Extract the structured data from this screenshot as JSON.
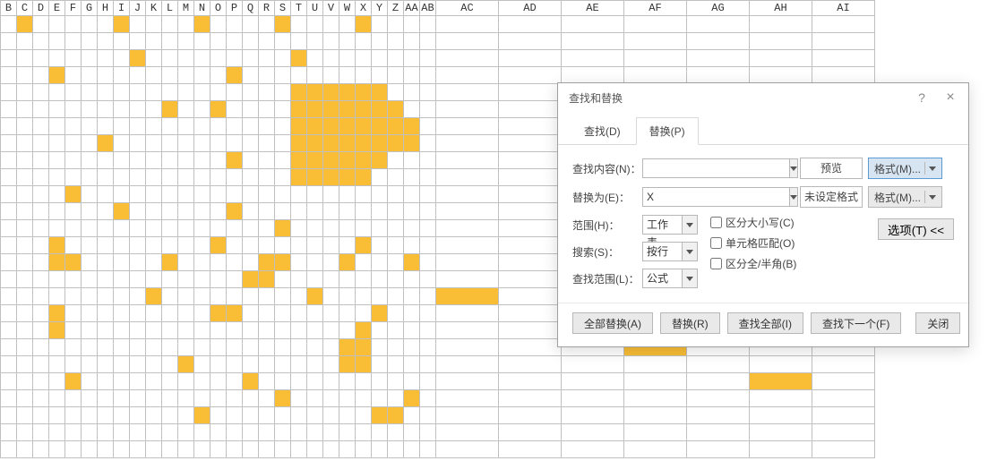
{
  "columns_narrow": [
    "B",
    "C",
    "D",
    "E",
    "F",
    "G",
    "H",
    "I",
    "J",
    "K",
    "L",
    "M",
    "N",
    "O",
    "P",
    "Q",
    "R",
    "S",
    "T",
    "U",
    "V",
    "W",
    "X",
    "Y",
    "Z",
    "AA",
    "AB"
  ],
  "columns_wide": [
    "AC",
    "AD",
    "AE",
    "AF",
    "AG",
    "AH",
    "AI"
  ],
  "fill_cells": [
    "r1c2",
    "r1c8",
    "r1c13",
    "r1c18",
    "r1c23",
    "r3c9",
    "r3c19",
    "r4c4",
    "r4c15",
    "r5c19",
    "r5c20",
    "r5c21",
    "r5c22",
    "r5c23",
    "r5c24",
    "r6c11",
    "r6c14",
    "r6c19",
    "r6c20",
    "r6c21",
    "r6c22",
    "r6c23",
    "r6c24",
    "r6c25",
    "r6c30",
    "r7c19",
    "r7c20",
    "r7c21",
    "r7c22",
    "r7c23",
    "r7c24",
    "r7c25",
    "r7c26",
    "r8c7",
    "r8c19",
    "r8c20",
    "r8c21",
    "r8c22",
    "r8c23",
    "r8c24",
    "r8c25",
    "r8c26",
    "r9c15",
    "r9c19",
    "r9c20",
    "r9c21",
    "r9c22",
    "r9c23",
    "r9c24",
    "r10c19",
    "r10c20",
    "r10c21",
    "r10c22",
    "r10c23",
    "r11c5",
    "r12c8",
    "r12c15",
    "r13c18",
    "r14c4",
    "r14c14",
    "r14c23",
    "r15c4",
    "r15c5",
    "r15c11",
    "r15c17",
    "r15c18",
    "r15c22",
    "r15c26",
    "r16c16",
    "r16c17",
    "r17c10",
    "r17c20",
    "r17c28",
    "r18c4",
    "r18c14",
    "r18c15",
    "r18c24",
    "r19c4",
    "r19c23",
    "r20c22",
    "r20c23",
    "r20c31",
    "r21c12",
    "r21c22",
    "r21c23",
    "r22c5",
    "r22c16",
    "r22c33",
    "r23c18",
    "r23c26",
    "r24c13",
    "r24c24",
    "r24c25"
  ],
  "dialog": {
    "title": "查找和替换",
    "tabs": {
      "find": "查找(D)",
      "replace": "替换(P)"
    },
    "find_label": "查找内容(N)：",
    "replace_label": "替换为(E)：",
    "find_value": "",
    "replace_value": "X",
    "preview": "预览",
    "no_format": "未设定格式",
    "format_btn": "格式(M)...",
    "scope_label": "范围(H)：",
    "scope_value": "工作表",
    "search_label": "搜索(S)：",
    "search_value": "按行",
    "lookin_label": "查找范围(L)：",
    "lookin_value": "公式",
    "chk_case": "区分大小写(C)",
    "chk_whole": "单元格匹配(O)",
    "chk_width": "区分全/半角(B)",
    "options_btn": "选项(T) <<",
    "btn_replace_all": "全部替换(A)",
    "btn_replace": "替换(R)",
    "btn_find_all": "查找全部(I)",
    "btn_find_next": "查找下一个(F)",
    "btn_close": "关闭"
  }
}
